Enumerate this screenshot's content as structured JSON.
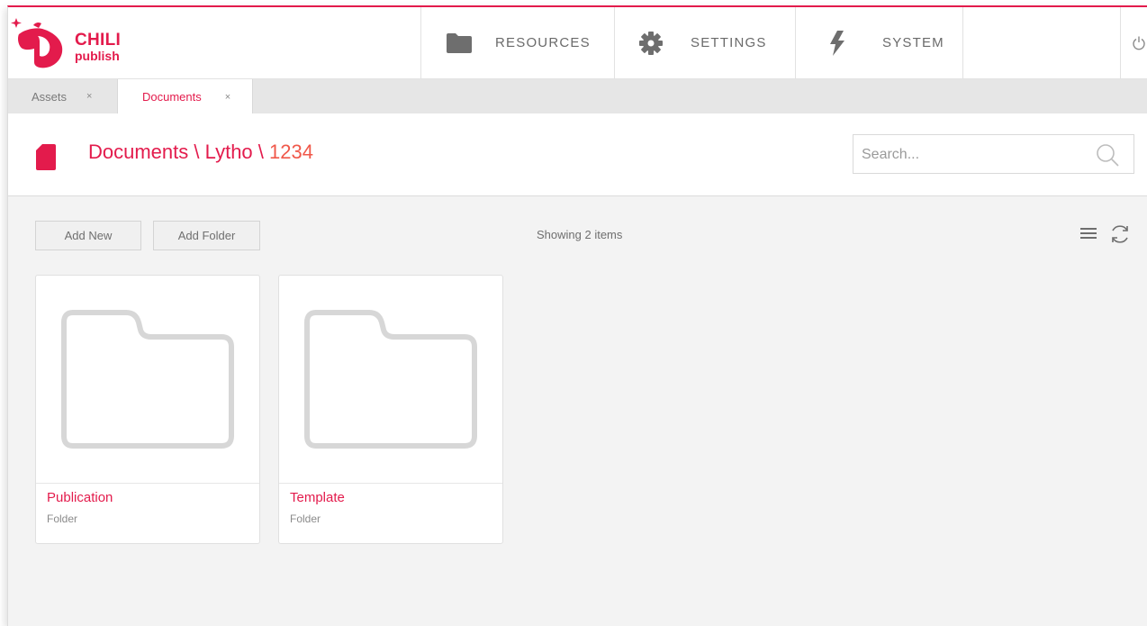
{
  "brand": {
    "name_top": "CHILI",
    "name_bottom": "publish",
    "color": "#e31b4c"
  },
  "nav": {
    "items": [
      {
        "label": "RESOURCES",
        "icon": "folder-icon"
      },
      {
        "label": "SETTINGS",
        "icon": "gear-icon"
      },
      {
        "label": "SYSTEM",
        "icon": "lightning-icon"
      }
    ],
    "power_icon": "power-icon"
  },
  "tabs": [
    {
      "label": "Assets",
      "close": "×",
      "active": false
    },
    {
      "label": "Documents",
      "close": "×",
      "active": true
    }
  ],
  "breadcrumb": {
    "parts": [
      "Documents",
      "Lytho"
    ],
    "separator": "\\",
    "current": "1234"
  },
  "search": {
    "placeholder": "Search..."
  },
  "toolbar": {
    "add_new": "Add New",
    "add_folder": "Add Folder",
    "count_text": "Showing 2 items"
  },
  "items": [
    {
      "name": "Publication",
      "type": "Folder"
    },
    {
      "name": "Template",
      "type": "Folder"
    }
  ],
  "colors": {
    "accent": "#e31b4c",
    "accent_light": "#f0584a",
    "background": "#f3f3f3"
  }
}
